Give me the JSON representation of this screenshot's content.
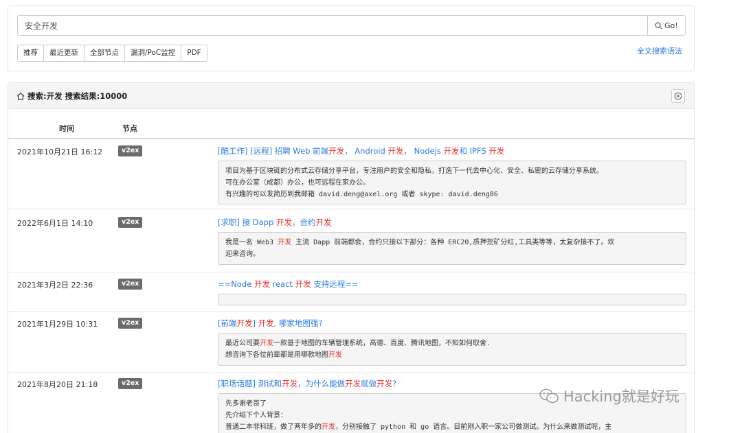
{
  "search": {
    "value": "安全开发",
    "go_label": "Go!"
  },
  "tabs": [
    {
      "label": "推荐"
    },
    {
      "label": "最近更新"
    },
    {
      "label": "全部节点"
    },
    {
      "label": "漏洞/PoC监控"
    },
    {
      "label": "PDF"
    }
  ],
  "syntax_link": "全文搜索语法",
  "panel": {
    "title": "搜索:开发 搜索结果:10000",
    "col_time": "时间",
    "col_node": "节点"
  },
  "results": [
    {
      "date": "2021年10月21日 16:12",
      "node": "v2ex",
      "title": [
        {
          "t": "[酷工作] [远程] 招聘 Web 前端"
        },
        {
          "t": "开发",
          "hl": true
        },
        {
          "t": "， Android "
        },
        {
          "t": "开发",
          "hl": true
        },
        {
          "t": "， Nodejs "
        },
        {
          "t": "开发",
          "hl": true
        },
        {
          "t": "和 IPFS "
        },
        {
          "t": "开发",
          "hl": true
        }
      ],
      "snippet": [
        [
          {
            "t": "项目为基于区块链的分布式云存储分享平台，专注用户的安全和隐私，打造下一代去中心化、安全、私密的云存储分享系统。"
          }
        ],
        [
          {
            "t": "可在办公室（成都）办公，也可远程在家办公。"
          }
        ],
        [
          {
            "t": "有兴趣的可以发简历到我邮箱 david.deng@axel.org 或者 skype: david.deng86"
          }
        ]
      ]
    },
    {
      "date": "2022年6月1日 14:10",
      "node": "v2ex",
      "title": [
        {
          "t": "[求职] 接 Dapp "
        },
        {
          "t": "开发",
          "hl": true
        },
        {
          "t": "，合约"
        },
        {
          "t": "开发",
          "hl": true
        }
      ],
      "snippet": [
        [
          {
            "t": "我是一名 Web3 "
          },
          {
            "t": "开发",
            "hl": true
          },
          {
            "t": " 主流 Dapp 前端都会，合约只接以下部分：各种 ERC20,质押挖矿分红,工具类等等，太复杂接不了。欢"
          }
        ],
        [
          {
            "t": "迎来咨询。"
          }
        ]
      ]
    },
    {
      "date": "2021年3月2日 22:36",
      "node": "v2ex",
      "title": [
        {
          "t": "==Node "
        },
        {
          "t": "开发",
          "hl": true
        },
        {
          "t": " react "
        },
        {
          "t": "开发",
          "hl": true
        },
        {
          "t": " 支持远程=="
        }
      ],
      "snippet": []
    },
    {
      "date": "2021年1月29日 10:31",
      "node": "v2ex",
      "title": [
        {
          "t": "[前端"
        },
        {
          "t": "开发",
          "hl": true
        },
        {
          "t": "] "
        },
        {
          "t": "开发",
          "hl": true
        },
        {
          "t": ", 哪家地图强?"
        }
      ],
      "snippet": [
        [
          {
            "t": "最近公司要"
          },
          {
            "t": "开发",
            "hl": true
          },
          {
            "t": "一款基于地图的车辆管理系统，高德、百度、腾讯地图，不知如何取舍."
          }
        ],
        [
          {
            "t": "想咨询下各位前辈都是用哪款地图"
          },
          {
            "t": "开发",
            "hl": true
          }
        ]
      ]
    },
    {
      "date": "2021年8月20日 21:18",
      "node": "v2ex",
      "title": [
        {
          "t": "[职场话题] 测试和"
        },
        {
          "t": "开发",
          "hl": true
        },
        {
          "t": "，为什么能做"
        },
        {
          "t": "开发",
          "hl": true
        },
        {
          "t": "就做"
        },
        {
          "t": "开发",
          "hl": true
        },
        {
          "t": "?"
        }
      ],
      "snippet": [
        [
          {
            "t": "先多谢老哥了"
          }
        ],
        [
          {
            "t": "先介绍下个人背景："
          }
        ],
        [
          {
            "t": "普通二本非科班，做了两年多的"
          },
          {
            "t": "开发",
            "hl": true
          },
          {
            "t": "，分别接触了 python 和 go 语言。目前刚入职一家公司做测试。为什么来做测试呢，主"
          }
        ]
      ]
    }
  ],
  "watermark": "Hacking就是好玩"
}
